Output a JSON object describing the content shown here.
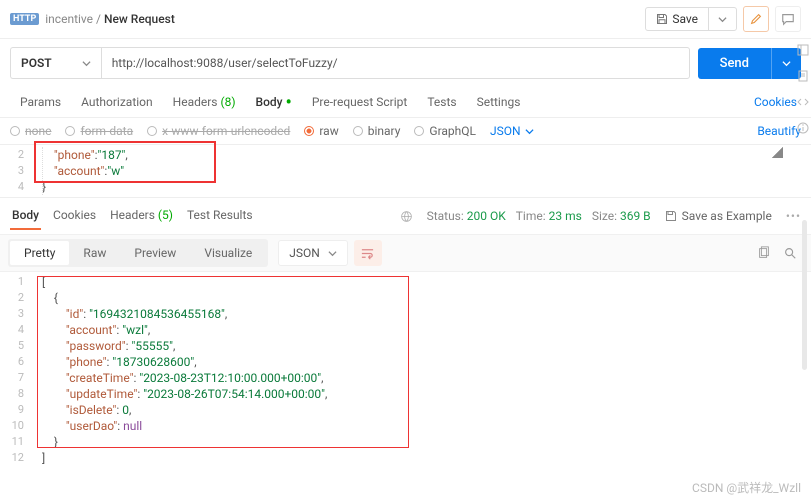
{
  "breadcrumb": {
    "workspace": "incentive",
    "separator": "/",
    "current": "New Request"
  },
  "toolbar": {
    "save": "Save"
  },
  "request": {
    "method": "POST",
    "url": "http://localhost:9088/user/selectToFuzzy/",
    "send": "Send"
  },
  "tabs": {
    "params": "Params",
    "auth": "Authorization",
    "headers": "Headers",
    "headers_count": "(8)",
    "body": "Body",
    "prerequest": "Pre-request Script",
    "tests": "Tests",
    "settings": "Settings",
    "cookies": "Cookies"
  },
  "body_types": {
    "none": "none",
    "formdata": "form-data",
    "urlencoded": "x-www-form-urlencoded",
    "raw": "raw",
    "binary": "binary",
    "graphql": "GraphQL",
    "format": "JSON",
    "beautify": "Beautify"
  },
  "request_body": {
    "lines": [
      "2",
      "3",
      "4"
    ],
    "content": [
      {
        "indent": "    ",
        "key": "phone",
        "sep": ":",
        "val": "\"187\"",
        "tail": ","
      },
      {
        "indent": "    ",
        "key": "account",
        "sep": ":",
        "val": "\"w\"",
        "tail": ""
      },
      {
        "indent": "",
        "raw": "}"
      }
    ]
  },
  "response": {
    "tabs": {
      "body": "Body",
      "cookies": "Cookies",
      "headers": "Headers",
      "headers_count": "(5)",
      "tests": "Test Results"
    },
    "status_label": "Status:",
    "status_code": "200 OK",
    "time_label": "Time:",
    "time_val": "23 ms",
    "size_label": "Size:",
    "size_val": "369 B",
    "save_example": "Save as Example"
  },
  "view_modes": {
    "pretty": "Pretty",
    "raw": "Raw",
    "preview": "Preview",
    "visualize": "Visualize",
    "json": "JSON"
  },
  "response_body": {
    "lines": [
      "1",
      "2",
      "3",
      "4",
      "5",
      "6",
      "7",
      "8",
      "9",
      "10",
      "11",
      "12"
    ],
    "rows": [
      {
        "t": "punc",
        "txt": "["
      },
      {
        "t": "punc",
        "txt": "    {"
      },
      {
        "t": "kv",
        "k": "id",
        "v": "\"1694321084536455168\"",
        "c": ","
      },
      {
        "t": "kv",
        "k": "account",
        "v": "\"wzl\"",
        "c": ","
      },
      {
        "t": "kv",
        "k": "password",
        "v": "\"55555\"",
        "c": ","
      },
      {
        "t": "kv",
        "k": "phone",
        "v": "\"18730628600\"",
        "c": ","
      },
      {
        "t": "kv",
        "k": "createTime",
        "v": "\"2023-08-23T12:10:00.000+00:00\"",
        "c": ","
      },
      {
        "t": "kv",
        "k": "updateTime",
        "v": "\"2023-08-26T07:54:14.000+00:00\"",
        "c": ","
      },
      {
        "t": "kvn",
        "k": "isDelete",
        "v": "0",
        "c": ","
      },
      {
        "t": "kvnull",
        "k": "userDao",
        "v": "null",
        "c": ""
      },
      {
        "t": "punc",
        "txt": "    }"
      },
      {
        "t": "punc",
        "txt": "]"
      }
    ]
  },
  "watermark": "CSDN @武祥龙_Wzll"
}
